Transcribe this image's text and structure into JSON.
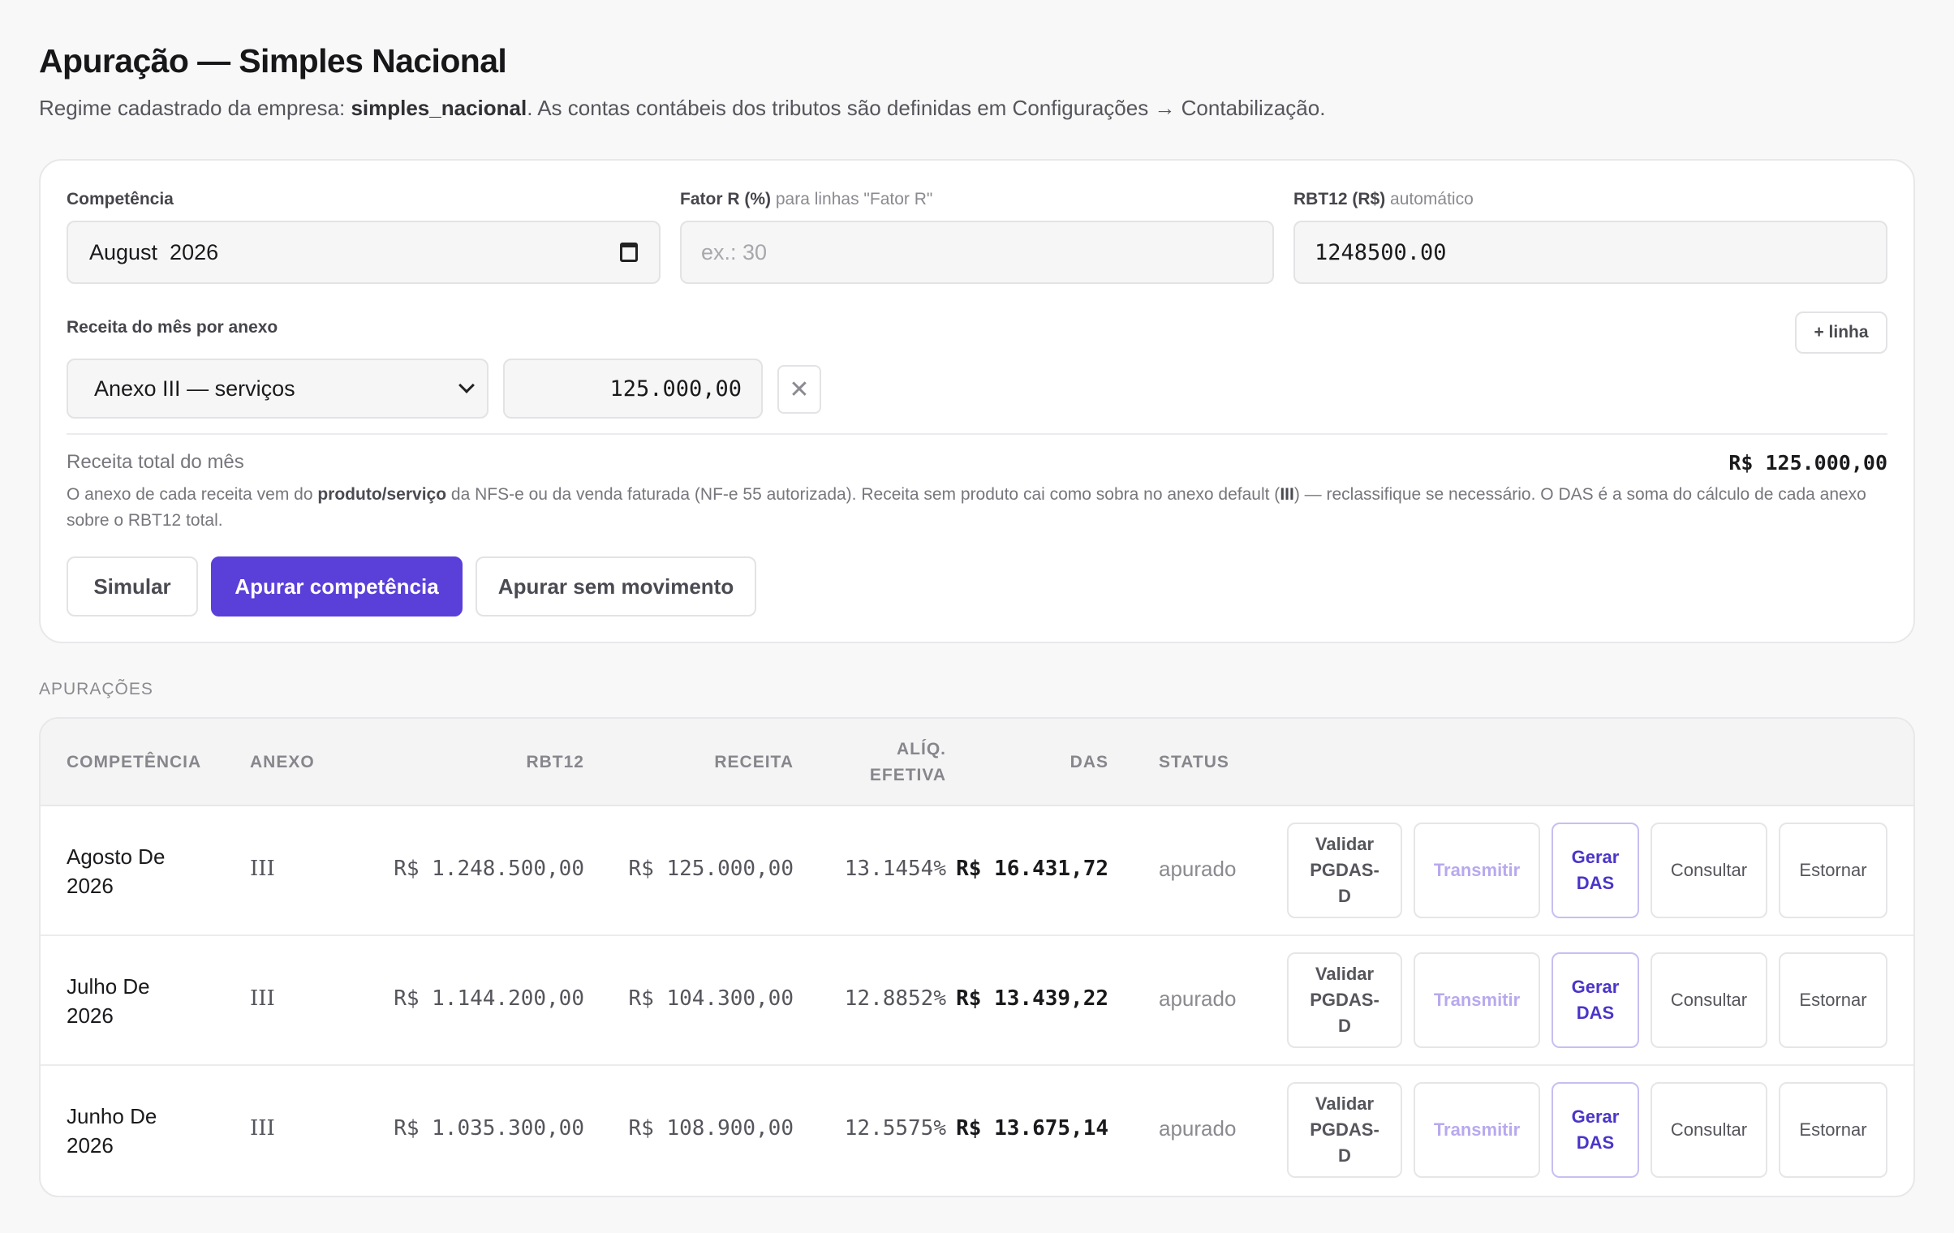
{
  "header": {
    "title": "Apuração — Simples Nacional",
    "subtitle_prefix": "Regime cadastrado da empresa: ",
    "subtitle_regime": "simples_nacional",
    "subtitle_suffix": ". As contas contábeis dos tributos são definidas em Configurações → Contabilização."
  },
  "form": {
    "competencia_label": "Competência",
    "competencia_value": "August  2026",
    "fator_label": "Fator R (%)",
    "fator_hint": "para linhas \"Fator R\"",
    "fator_placeholder": "ex.: 30",
    "rbt12_label": "RBT12 (R$)",
    "rbt12_hint": "automático",
    "rbt12_value": "1248500.00",
    "receita_label": "Receita do mês por anexo",
    "add_line_label": "+ linha",
    "anexo_selected": "Anexo III — serviços",
    "anexo_amount": "125.000,00",
    "remove_icon": "close-icon",
    "total_label": "Receita total do mês",
    "total_value": "R$ 125.000,00",
    "note_1": "O anexo de cada receita vem do ",
    "note_b1": "produto/serviço",
    "note_2": " da NFS-e ou da venda faturada (NF-e 55 autorizada). Receita sem produto cai como sobra no anexo default (",
    "note_b2": "III",
    "note_3": ") — reclassifique se necessário. O DAS é a soma do cálculo de cada anexo sobre o RBT12 total.",
    "simular_label": "Simular",
    "apurar_label": "Apurar competência",
    "sem_movimento_label": "Apurar sem movimento"
  },
  "section_title": "APURAÇÕES",
  "table": {
    "headers": {
      "competencia": "COMPETÊNCIA",
      "anexo": "ANEXO",
      "rbt12": "RBT12",
      "receita": "RECEITA",
      "aliq_1": "ALÍQ.",
      "aliq_2": "EFETIVA",
      "das": "DAS",
      "status": "STATUS"
    },
    "actions": {
      "validar_1": "Validar",
      "validar_2": "PGDAS-",
      "validar_3": "D",
      "transmitir": "Transmitir",
      "gerar_1": "Gerar",
      "gerar_2": "DAS",
      "consultar": "Consultar",
      "estornar": "Estornar"
    },
    "rows": [
      {
        "comp_1": "Agosto De",
        "comp_2": "2026",
        "anexo": "III",
        "rbt12": "R$ 1.248.500,00",
        "receita": "R$ 125.000,00",
        "aliq": "13.1454%",
        "das": "R$ 16.431,72",
        "status": "apurado"
      },
      {
        "comp_1": "Julho De",
        "comp_2": "2026",
        "anexo": "III",
        "rbt12": "R$ 1.144.200,00",
        "receita": "R$ 104.300,00",
        "aliq": "12.8852%",
        "das": "R$ 13.439,22",
        "status": "apurado"
      },
      {
        "comp_1": "Junho De",
        "comp_2": "2026",
        "anexo": "III",
        "rbt12": "R$ 1.035.300,00",
        "receita": "R$ 108.900,00",
        "aliq": "12.5575%",
        "das": "R$ 13.675,14",
        "status": "apurado"
      }
    ]
  },
  "colors": {
    "accent": "#5b3fd9",
    "link": "#4a35c9",
    "disabled": "#b8a9ee"
  }
}
